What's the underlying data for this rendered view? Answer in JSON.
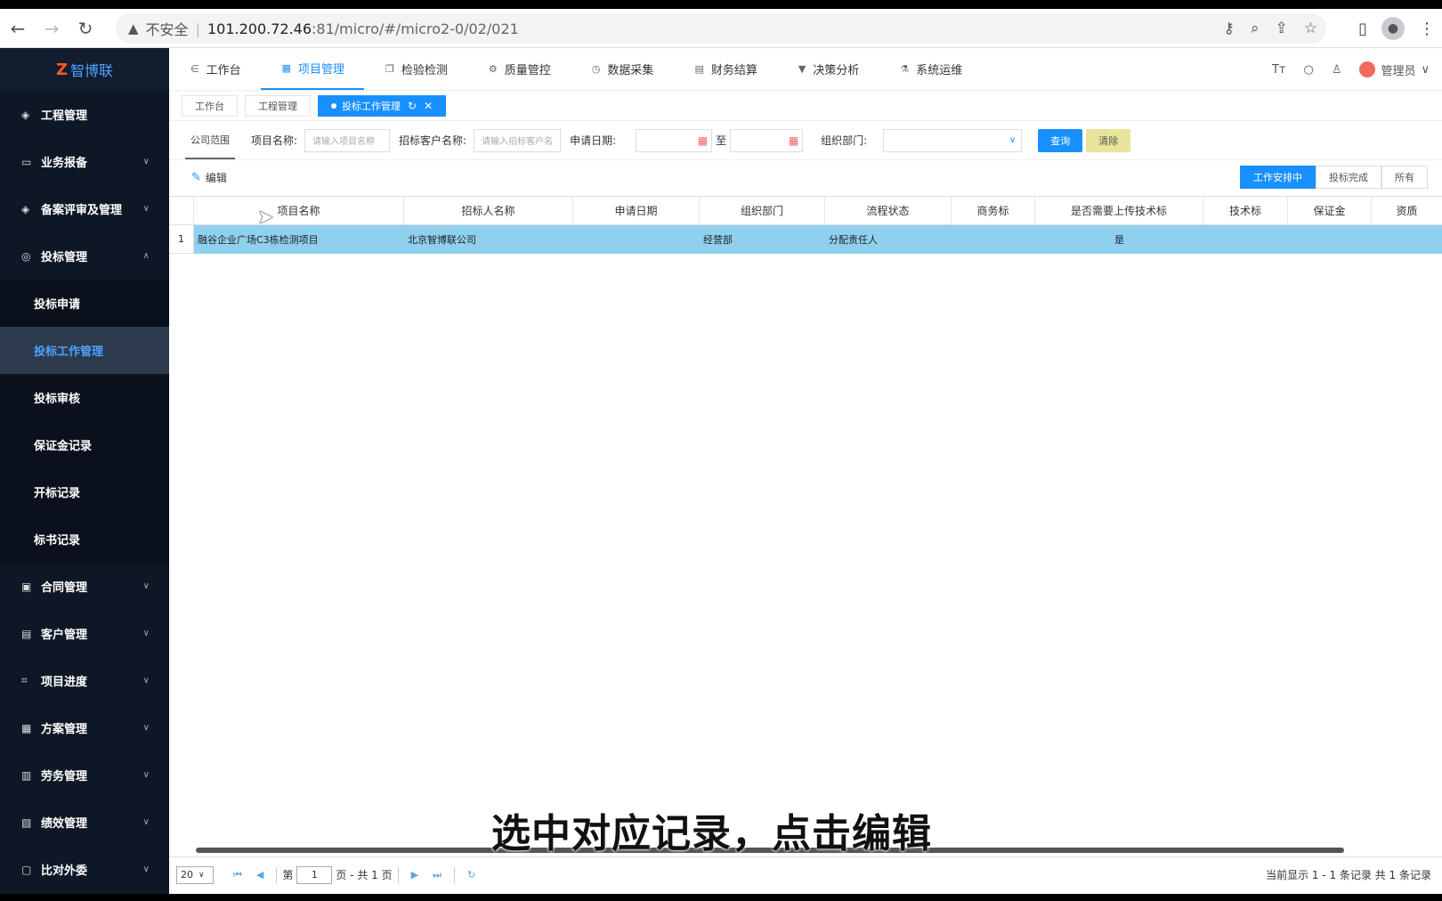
{
  "browser": {
    "insecure_label": "不安全",
    "url_host": "101.200.72.46",
    "url_path": ":81/micro/#/micro2-0/02/021"
  },
  "sidebar": {
    "logo": "智博联",
    "items": [
      {
        "label": "工程管理",
        "icon": "shield-icon"
      },
      {
        "label": "业务报备",
        "icon": "briefcase-icon"
      },
      {
        "label": "备案评审及管理",
        "icon": "shield-icon"
      },
      {
        "label": "投标管理",
        "icon": "target-icon"
      },
      {
        "label": "投标申请"
      },
      {
        "label": "投标工作管理"
      },
      {
        "label": "投标审核"
      },
      {
        "label": "保证金记录"
      },
      {
        "label": "开标记录"
      },
      {
        "label": "标书记录"
      },
      {
        "label": "合同管理",
        "icon": "contract-icon"
      },
      {
        "label": "客户管理",
        "icon": "customer-icon"
      },
      {
        "label": "项目进度",
        "icon": "progress-icon"
      },
      {
        "label": "方案管理",
        "icon": "plan-icon"
      },
      {
        "label": "劳务管理",
        "icon": "labor-icon"
      },
      {
        "label": "绩效管理",
        "icon": "performance-icon"
      },
      {
        "label": "比对外委",
        "icon": "lock-icon"
      }
    ]
  },
  "topnav": {
    "items": [
      "工作台",
      "项目管理",
      "检验检测",
      "质量管控",
      "数据采集",
      "财务结算",
      "决策分析",
      "系统运维"
    ],
    "user": "管理员"
  },
  "tabs": [
    "工作台",
    "工程管理",
    "投标工作管理"
  ],
  "filter": {
    "scope": "公司范围",
    "project_label": "项目名称:",
    "project_placeholder": "请输入项目名称",
    "client_label": "招标客户名称:",
    "client_placeholder": "请输入招标客户名",
    "date_label": "申请日期:",
    "date_to": "至",
    "dept_label": "组织部门:",
    "query": "查询",
    "clear": "清除"
  },
  "toolbar": {
    "edit": "编辑",
    "status_tabs": [
      "工作安排中",
      "投标完成",
      "所有"
    ]
  },
  "table": {
    "columns": [
      "项目名称",
      "招标人名称",
      "申请日期",
      "组织部门",
      "流程状态",
      "商务标",
      "是否需要上传技术标",
      "技术标",
      "保证金",
      "资质"
    ],
    "rows": [
      {
        "idx": "1",
        "project": "融谷企业广场C3栋检测项目",
        "bidder": "北京智博联公司",
        "date": "",
        "dept": "经营部",
        "status": "分配责任人",
        "business": "",
        "need_tech": "是",
        "tech": "",
        "deposit": "",
        "qual": ""
      }
    ]
  },
  "pager": {
    "page_size": "20",
    "page_prefix": "第",
    "page": "1",
    "page_suffix": "页 - 共 1 页",
    "info": "当前显示 1 - 1 条记录 共 1 条记录"
  },
  "caption": "选中对应记录，点击编辑",
  "colors": {
    "accent": "#1890ff",
    "sidebar_bg": "#0e1726",
    "selected_row": "#8fd0ef"
  }
}
